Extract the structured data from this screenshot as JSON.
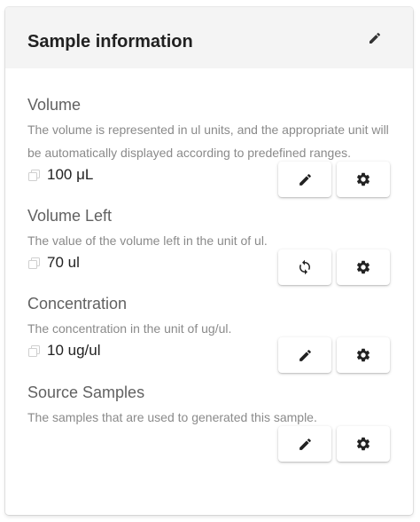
{
  "card": {
    "title": "Sample information",
    "edit_icon": "pencil-icon"
  },
  "fields": [
    {
      "label": "Volume",
      "description_lines": [
        "The volume is represented in ul units, and the appropriate unit will",
        "be automatically displayed according to predefined ranges."
      ],
      "value": "100 μL",
      "actions": [
        "pencil-icon",
        "gear-icon"
      ]
    },
    {
      "label": "Volume Left",
      "description_lines": [
        "The value of the volume left in the unit of ul."
      ],
      "value": "70 ul",
      "actions": [
        "refresh-icon",
        "gear-icon"
      ]
    },
    {
      "label": "Concentration",
      "description_lines": [
        "The concentration in the unit of ug/ul."
      ],
      "value": "10 ug/ul",
      "actions": [
        "pencil-icon",
        "gear-icon"
      ]
    },
    {
      "label": "Source Samples",
      "description_lines": [
        "The samples that are used to generated this sample."
      ],
      "value": "",
      "actions": [
        "pencil-icon",
        "gear-icon"
      ]
    }
  ]
}
